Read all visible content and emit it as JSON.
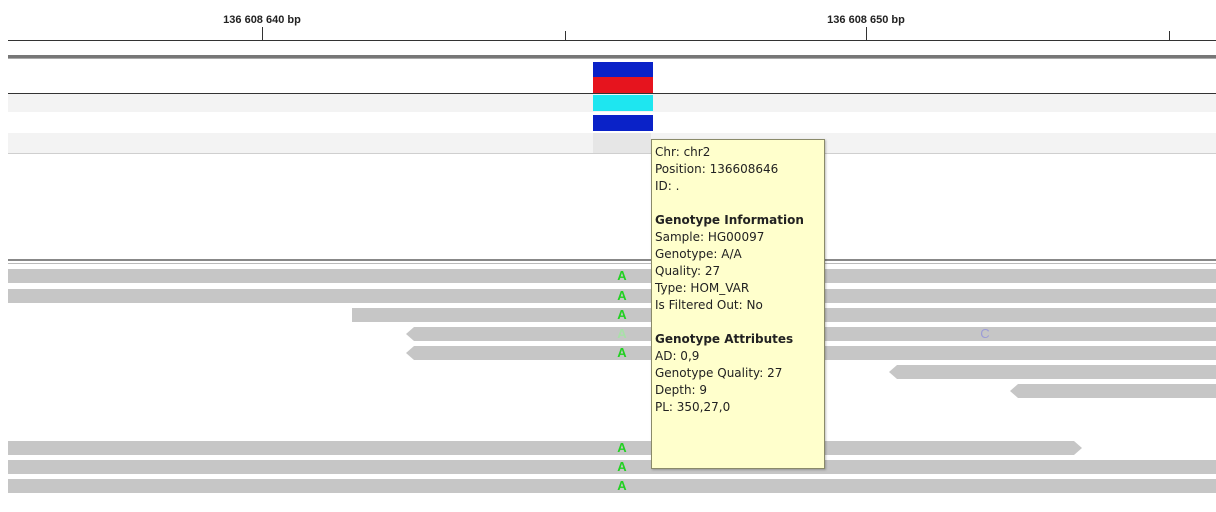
{
  "ruler": {
    "labels": [
      "136 608 640 bp",
      "136 608 650 bp"
    ]
  },
  "tooltip": {
    "site": {
      "chr": "Chr: chr2",
      "position": "Position: 136608646",
      "id": "ID: ."
    },
    "genotype_info": {
      "header": "Genotype Information",
      "sample": "Sample: HG00097",
      "genotype": "Genotype: A/A",
      "quality": "Quality: 27",
      "type": "Type: HOM_VAR",
      "filtered": "Is Filtered Out: No"
    },
    "genotype_attrs": {
      "header": "Genotype Attributes",
      "ad": "AD: 0,9",
      "gq": "Genotype Quality: 27",
      "depth": "Depth: 9",
      "pl": "PL: 350,27,0"
    }
  },
  "alignment": {
    "mismatch_base": "A",
    "other_base": "C"
  },
  "colors": {
    "variant_dark_blue": "#0a22c8",
    "variant_red": "#e6141e",
    "variant_cyan": "#1ee6f0",
    "mismatch_green": "#22d022",
    "mismatch_green_faded": "#a8e0a8",
    "mismatch_c": "#9c9cd6",
    "read_gray": "#c6c6c6",
    "tooltip_bg": "#ffffcc"
  }
}
